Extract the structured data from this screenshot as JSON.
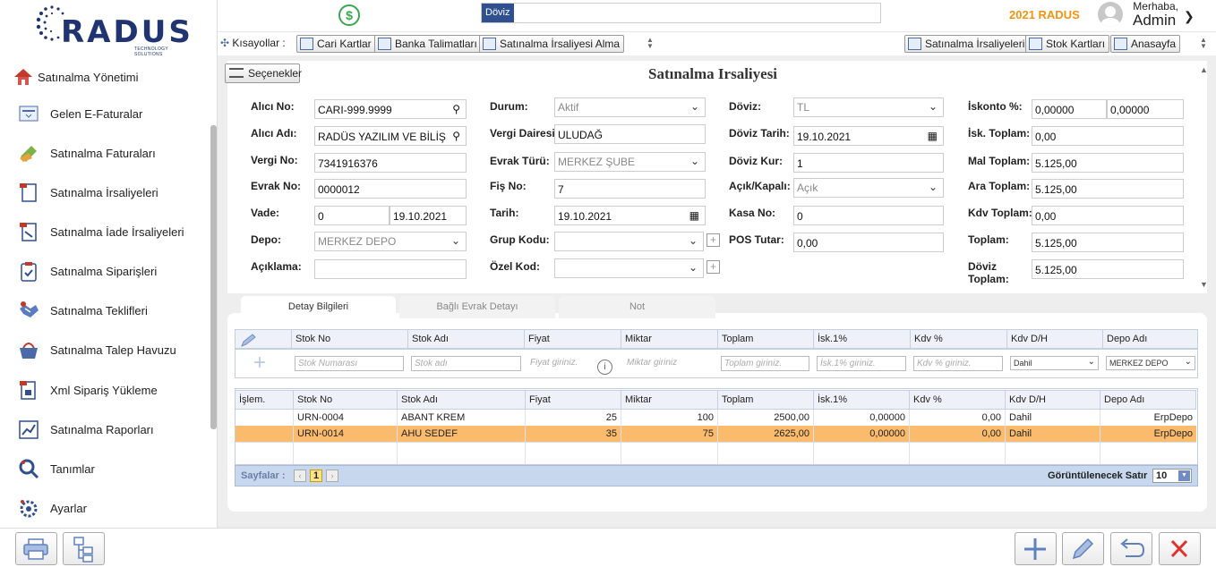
{
  "brand": {
    "logo_text": "RADUS",
    "tagline": "TECHNOLOGY SOLUTIONS",
    "year_label": "2021 RADUS"
  },
  "header": {
    "currency_symbol": "$",
    "doviz_label": "Döviz",
    "greeting": "Merhaba,",
    "user": "Admin"
  },
  "sidebar": {
    "items": [
      {
        "label": "Satınalma Yönetimi",
        "icon": "house-icon"
      },
      {
        "label": "Gelen E-Faturalar",
        "icon": "invoice-icon"
      },
      {
        "label": "Satınalma Faturaları",
        "icon": "money-icon"
      },
      {
        "label": "Satınalma İrsaliyeleri",
        "icon": "document-icon"
      },
      {
        "label": "Satınalma İade İrsaliyeleri",
        "icon": "return-doc-icon"
      },
      {
        "label": "Satınalma Siparişleri",
        "icon": "clipboard-check-icon"
      },
      {
        "label": "Satınalma Teklifleri",
        "icon": "handshake-icon"
      },
      {
        "label": "Satınalma Talep Havuzu",
        "icon": "basket-icon"
      },
      {
        "label": "Xml Sipariş Yükleme",
        "icon": "xml-upload-icon"
      },
      {
        "label": "Satınalma Raporları",
        "icon": "chart-icon"
      },
      {
        "label": "Tanımlar",
        "icon": "search-icon"
      },
      {
        "label": "Ayarlar",
        "icon": "gear-icon"
      }
    ]
  },
  "shortcuts": {
    "label": "Kısayollar :",
    "left": [
      "Cari Kartlar",
      "Banka Talimatları",
      "Satınalma İrsaliyesi Alma"
    ],
    "right": [
      "Satınalma İrsaliyeleri",
      "Stok Kartları",
      "Anasayfa"
    ]
  },
  "form": {
    "options_label": "Seçenekler",
    "title": "Satınalma Irsaliyesi",
    "alici_no": {
      "label": "Alıcı No:",
      "value": "CARI-999.9999"
    },
    "alici_adi": {
      "label": "Alıcı Adı:",
      "value": "RADÜS YAZILIM VE BİLİŞ"
    },
    "vergi_no": {
      "label": "Vergi No:",
      "value": "7341916376"
    },
    "evrak_no": {
      "label": "Evrak No:",
      "value": "0000012"
    },
    "vade": {
      "label": "Vade:",
      "value": "0",
      "date": "19.10.2021"
    },
    "depo": {
      "label": "Depo:",
      "value": "MERKEZ DEPO"
    },
    "aciklama": {
      "label": "Açıklama:",
      "value": ""
    },
    "durum": {
      "label": "Durum:",
      "value": "Aktif"
    },
    "vergi_dairesi": {
      "label": "Vergi Dairesi:",
      "value": "ULUDAĞ"
    },
    "evrak_turu": {
      "label": "Evrak Türü:",
      "value": "MERKEZ ŞUBE"
    },
    "fis_no": {
      "label": "Fiş No:",
      "value": "7"
    },
    "tarih": {
      "label": "Tarih:",
      "value": "19.10.2021"
    },
    "grup_kodu": {
      "label": "Grup Kodu:",
      "value": ""
    },
    "ozel_kod": {
      "label": "Özel Kod:",
      "value": ""
    },
    "doviz": {
      "label": "Döviz:",
      "value": "TL"
    },
    "doviz_tarih": {
      "label": "Döviz Tarih:",
      "value": "19.10.2021"
    },
    "doviz_kur": {
      "label": "Döviz Kur:",
      "value": "1"
    },
    "acik_kapali": {
      "label": "Açık/Kapalı:",
      "value": "Açık"
    },
    "kasa_no": {
      "label": "Kasa No:",
      "value": "0"
    },
    "pos_tutar": {
      "label": "POS Tutar:",
      "value": "0,00"
    },
    "iskonto": {
      "label": "İskonto %:",
      "value1": "0,00000",
      "value2": "0,00000"
    },
    "isk_toplam": {
      "label": "İsk. Toplam:",
      "value": "0,00"
    },
    "mal_toplam": {
      "label": "Mal Toplam:",
      "value": "5.125,00"
    },
    "ara_toplam": {
      "label": "Ara Toplam:",
      "value": "5.125,00"
    },
    "kdv_toplam": {
      "label": "Kdv Toplam:",
      "value": "0,00"
    },
    "toplam": {
      "label": "Toplam:",
      "value": "5.125,00"
    },
    "doviz_toplam": {
      "label": "Döviz Toplam:",
      "value": "5.125,00"
    }
  },
  "tabs": [
    "Detay Bilgileri",
    "Bağlı Evrak Detayı",
    "Not"
  ],
  "entry_grid": {
    "columns": [
      "Stok No",
      "Stok Adı",
      "Fiyat",
      "Miktar",
      "Toplam",
      "İsk.1%",
      "Kdv %",
      "Kdv D/H",
      "Depo Adı"
    ],
    "placeholders": [
      "Stok Numarası",
      "Stok adı",
      "Fiyat giriniz.",
      "Miktar giriniz",
      "Toplam giriniz.",
      "İsk.1% giriniz.",
      "Kdv % giriniz."
    ],
    "kdv_dh_value": "Dahil",
    "depo_value": "MERKEZ DEPO"
  },
  "data_grid": {
    "columns": [
      "İşlem.",
      "Stok No",
      "Stok Adı",
      "Fiyat",
      "Miktar",
      "Toplam",
      "İsk.1%",
      "Kdv %",
      "Kdv D/H",
      "Depo Adı"
    ],
    "rows": [
      [
        "",
        "URN-0004",
        "ABANT KREM",
        "25",
        "100",
        "2500,00",
        "0,00000",
        "0,00",
        "Dahil",
        "ErpDepo"
      ],
      [
        "",
        "URN-0014",
        "AHU SEDEF",
        "35",
        "75",
        "2625,00",
        "0,00000",
        "0,00",
        "Dahil",
        "ErpDepo"
      ]
    ],
    "selected_row": 1,
    "highlight_color": "#fbbb6c"
  },
  "pager": {
    "label": "Sayfalar :",
    "page": "1",
    "rows_label": "Görüntülenecek Satır",
    "rows_value": "10"
  }
}
